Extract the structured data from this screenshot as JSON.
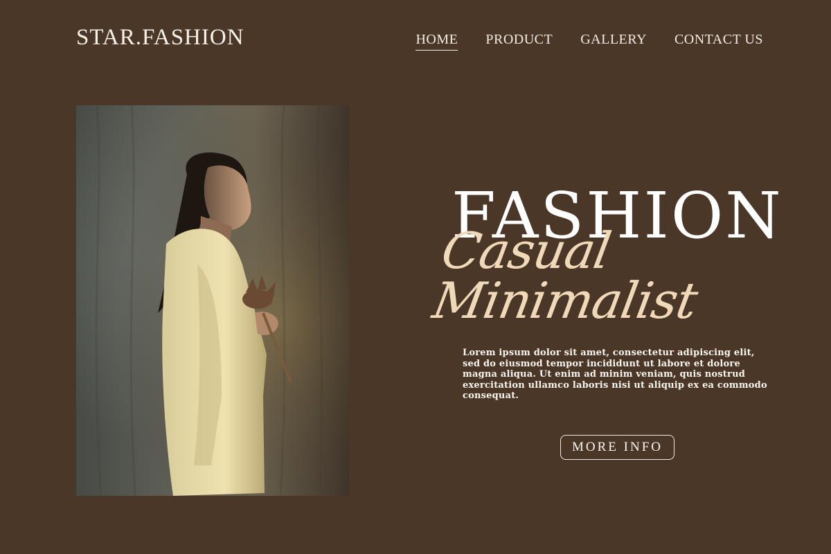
{
  "header": {
    "logo": "STAR.FASHION",
    "nav": [
      {
        "label": "HOME",
        "active": true
      },
      {
        "label": "PRODUCT",
        "active": false
      },
      {
        "label": "GALLERY",
        "active": false
      },
      {
        "label": "CONTACT US",
        "active": false
      }
    ]
  },
  "hero": {
    "title": "FASHION",
    "script": "Casual Minimalist",
    "description": "Lorem ipsum dolor sit amet, consectetur adipiscing elit, sed do eiusmod tempor incididunt ut labore et dolore magna aliqua. Ut enim ad minim veniam, quis nostrud exercitation ullamco laboris nisi ut aliquip ex ea commodo consequat.",
    "button_label": "MORE INFO",
    "image_alt": "woman-in-cream-blazer-holding-dried-flower"
  },
  "colors": {
    "background": "#4a3727",
    "text": "#ffffff",
    "accent_script": "#f0d9b8"
  }
}
